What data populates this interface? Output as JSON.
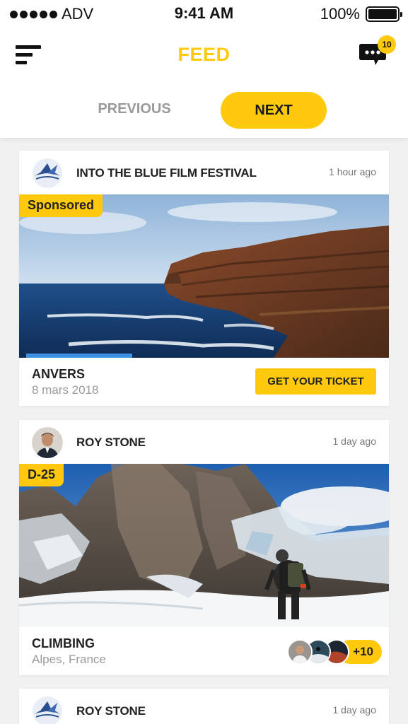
{
  "status_bar": {
    "carrier": "ADV",
    "time": "9:41 AM",
    "battery": "100%"
  },
  "header": {
    "title": "FEED",
    "notification_count": "10"
  },
  "tabs": {
    "previous": "PREVIOUS",
    "next": "NEXT"
  },
  "feed": [
    {
      "author": "INTO THE BLUE FILM FESTIVAL",
      "time": "1 hour ago",
      "tag": "Sponsored",
      "title": "ANVERS",
      "subtitle": "8 mars 2018",
      "action": "GET YOUR TICKET"
    },
    {
      "author": "ROY STONE",
      "time": "1 day ago",
      "tag": "D-25",
      "title": "CLIMBING",
      "subtitle": "Alpes, France",
      "participants_more": "+10"
    },
    {
      "author": "ROY STONE",
      "time": "1 day ago"
    }
  ],
  "colors": {
    "accent": "#ffc90e",
    "text": "#222222",
    "muted": "#9a9a9a"
  },
  "icons": [
    "menu-icon",
    "chat-icon",
    "bird-logo-icon",
    "avatar"
  ]
}
